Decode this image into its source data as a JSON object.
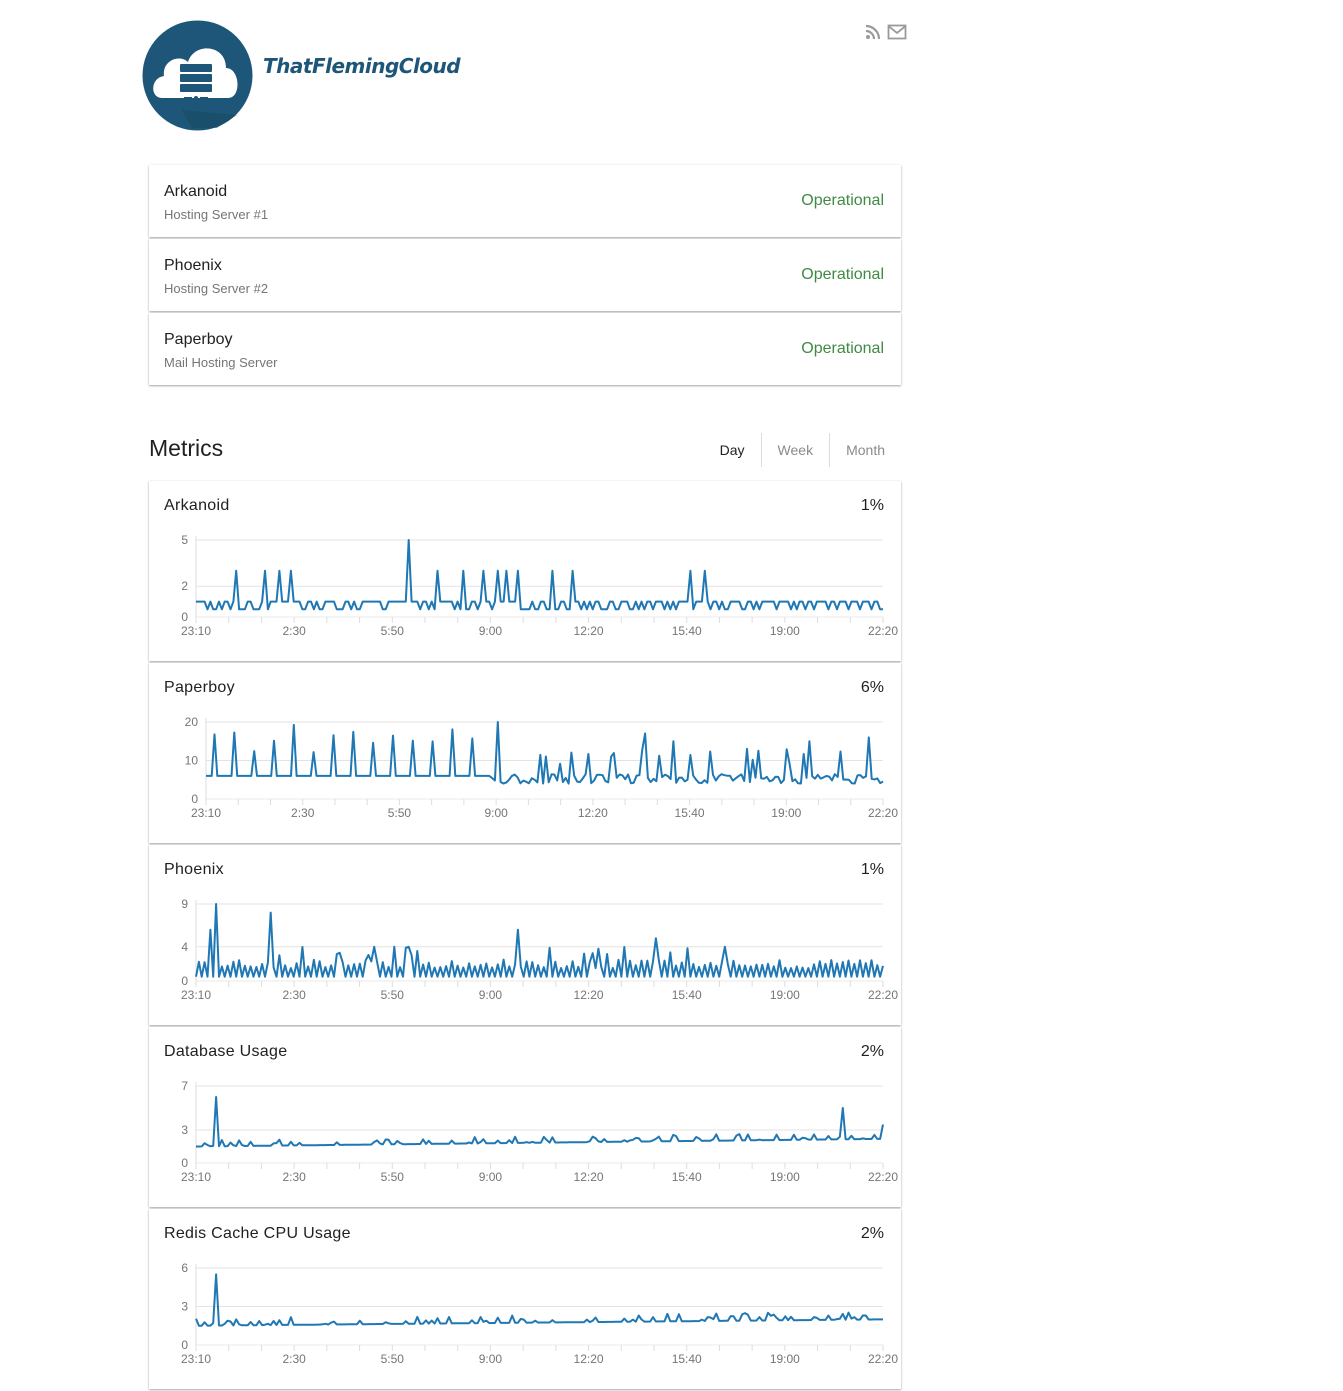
{
  "header": {
    "brand": "ThatFlemingCloud",
    "icons": [
      "rss-icon",
      "mail-icon"
    ]
  },
  "components": [
    {
      "name": "Arkanoid",
      "description": "Hosting Server #1",
      "status": "Operational"
    },
    {
      "name": "Phoenix",
      "description": "Hosting Server #2",
      "status": "Operational"
    },
    {
      "name": "Paperboy",
      "description": "Mail Hosting Server",
      "status": "Operational"
    }
  ],
  "colors": {
    "operational": "#3f8b43",
    "series": "#1f77b4",
    "brand": "#1d5678"
  },
  "metrics_section": {
    "title": "Metrics",
    "tabs": [
      {
        "label": "Day",
        "active": true
      },
      {
        "label": "Week",
        "active": false
      },
      {
        "label": "Month",
        "active": false
      }
    ]
  },
  "chart_data": [
    {
      "type": "line",
      "title": "Arkanoid",
      "current": "1%",
      "x_ticks": [
        "23:10",
        "2:30",
        "5:50",
        "9:00",
        "12:20",
        "15:40",
        "19:00",
        "22:20"
      ],
      "y_ticks": [
        0,
        2,
        5
      ],
      "ylim": [
        0,
        5
      ],
      "grid": true,
      "base": 1,
      "low": 0.5,
      "pattern": "spiky",
      "spikes": [
        [
          0.06,
          3
        ],
        [
          0.1,
          3
        ],
        [
          0.12,
          3
        ],
        [
          0.14,
          3
        ],
        [
          0.31,
          5
        ],
        [
          0.35,
          3
        ],
        [
          0.39,
          3
        ],
        [
          0.42,
          3
        ],
        [
          0.44,
          3
        ],
        [
          0.45,
          3
        ],
        [
          0.47,
          3
        ],
        [
          0.52,
          3
        ],
        [
          0.55,
          3
        ],
        [
          0.72,
          3
        ],
        [
          0.74,
          3
        ]
      ],
      "dip_rate": 0.35
    },
    {
      "type": "line",
      "title": "Paperboy",
      "current": "6%",
      "x_ticks": [
        "23:10",
        "2:30",
        "5:50",
        "9:00",
        "12:20",
        "15:40",
        "19:00",
        "22:20"
      ],
      "y_ticks": [
        0,
        10,
        20
      ],
      "ylim": [
        0,
        20
      ],
      "grid": true,
      "base": 6,
      "low": 4,
      "pattern": "periodic",
      "spikes": [
        [
          0.43,
          20
        ],
        [
          0.65,
          17
        ],
        [
          0.69,
          15
        ],
        [
          0.8,
          13
        ],
        [
          0.89,
          15
        ],
        [
          0.98,
          16
        ]
      ],
      "dip_rate": 0.2
    },
    {
      "type": "line",
      "title": "Phoenix",
      "current": "1%",
      "x_ticks": [
        "23:10",
        "2:30",
        "5:50",
        "9:00",
        "12:20",
        "15:40",
        "19:00",
        "22:20"
      ],
      "y_ticks": [
        0,
        4,
        9
      ],
      "ylim": [
        0,
        9
      ],
      "grid": true,
      "base": 1,
      "low": 0.5,
      "pattern": "noisy",
      "spikes": [
        [
          0.02,
          6
        ],
        [
          0.03,
          9
        ],
        [
          0.11,
          8
        ],
        [
          0.12,
          3
        ],
        [
          0.26,
          4
        ],
        [
          0.29,
          4
        ],
        [
          0.31,
          4
        ],
        [
          0.47,
          6
        ],
        [
          0.67,
          5
        ],
        [
          0.77,
          4
        ]
      ],
      "dip_rate": 0.5
    },
    {
      "type": "line",
      "title": "Database Usage",
      "current": "2%",
      "x_ticks": [
        "23:10",
        "2:30",
        "5:50",
        "9:00",
        "12:20",
        "15:40",
        "19:00",
        "22:20"
      ],
      "y_ticks": [
        0,
        3,
        7
      ],
      "ylim": [
        0,
        7
      ],
      "grid": true,
      "base": 1.5,
      "low": 1.4,
      "pattern": "flat",
      "spikes": [
        [
          0.03,
          6
        ],
        [
          0.94,
          5
        ],
        [
          1.0,
          3.5
        ]
      ],
      "trend_end": 2.2
    },
    {
      "type": "line",
      "title": "Redis Cache CPU Usage",
      "current": "2%",
      "x_ticks": [
        "23:10",
        "2:30",
        "5:50",
        "9:00",
        "12:20",
        "15:40",
        "19:00",
        "22:20"
      ],
      "y_ticks": [
        0,
        3,
        6
      ],
      "ylim": [
        0,
        6
      ],
      "grid": true,
      "base": 1.5,
      "low": 1.4,
      "pattern": "flat",
      "spikes": [
        [
          0.03,
          5.5
        ]
      ],
      "trend_end": 2
    }
  ]
}
